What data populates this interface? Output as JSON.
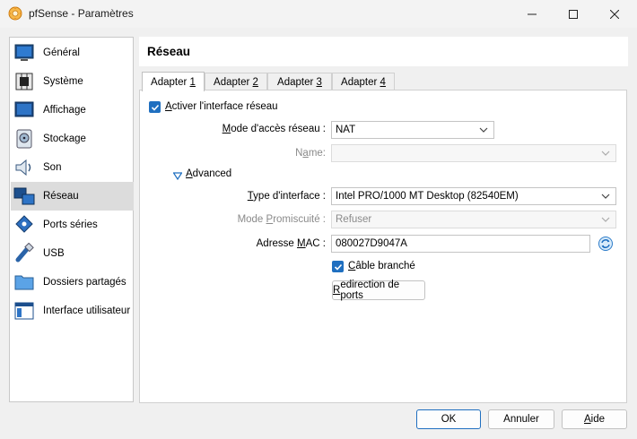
{
  "window": {
    "title": "pfSense - Paramètres"
  },
  "sidebar": {
    "items": [
      {
        "label": "Général"
      },
      {
        "label": "Système"
      },
      {
        "label": "Affichage"
      },
      {
        "label": "Stockage"
      },
      {
        "label": "Son"
      },
      {
        "label": "Réseau"
      },
      {
        "label": "Ports séries"
      },
      {
        "label": "USB"
      },
      {
        "label": "Dossiers partagés"
      },
      {
        "label": "Interface utilisateur"
      }
    ],
    "selected": "Réseau"
  },
  "page": {
    "title": "Réseau"
  },
  "tabs": [
    {
      "pre": "Adapter ",
      "key": "1"
    },
    {
      "pre": "Adapter ",
      "key": "2"
    },
    {
      "pre": "Adapter ",
      "key": "3"
    },
    {
      "pre": "Adapter ",
      "key": "4"
    }
  ],
  "form": {
    "enable": {
      "key": "A",
      "rest": "ctiver l'interface réseau"
    },
    "attach": {
      "key": "M",
      "rest": "ode d'accès réseau :",
      "value": "NAT"
    },
    "name": {
      "pre": "N",
      "key": "a",
      "rest": "me:",
      "value": ""
    },
    "advanced": {
      "key": "A",
      "rest": "dvanced"
    },
    "adapter_type": {
      "key": "T",
      "rest": "ype d'interface :",
      "value": "Intel PRO/1000 MT Desktop (82540EM)"
    },
    "promisc": {
      "pre": "Mode ",
      "key": "P",
      "rest": "romiscuité :",
      "value": "Refuser"
    },
    "mac": {
      "pre": "Adresse ",
      "key": "M",
      "rest": "AC :",
      "value": "080027D9047A"
    },
    "cable": {
      "key": "C",
      "rest": "âble branché"
    },
    "port_fwd": {
      "pre": "",
      "key": "R",
      "rest": "edirection de ports"
    }
  },
  "buttons": {
    "ok": "OK",
    "cancel": "Annuler",
    "help_key": "A",
    "help_rest": "ide"
  },
  "colors": {
    "accent": "#1f6fc0",
    "selected_item": "#dcdcdc"
  }
}
